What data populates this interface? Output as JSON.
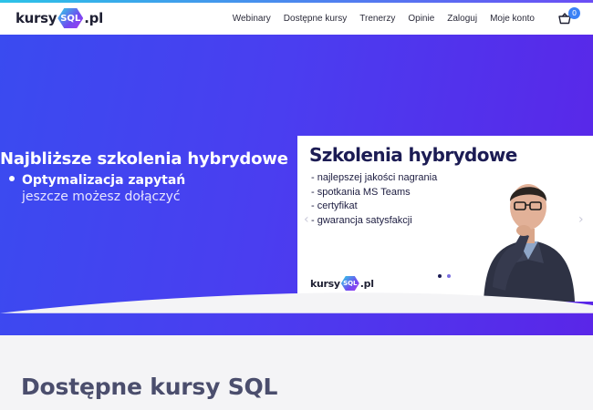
{
  "logo": {
    "left": "kursy",
    "badge": "SQL",
    "right": ".pl"
  },
  "nav": {
    "items": [
      "Webinary",
      "Dostępne kursy",
      "Trenerzy",
      "Opinie",
      "Zaloguj",
      "Moje konto"
    ]
  },
  "cart": {
    "count": "0"
  },
  "hero": {
    "title": "Najbliższe szkolenia hybrydowe",
    "course": "Optymalizacja zapytań",
    "subtitle": "jeszcze możesz dołączyć"
  },
  "slide": {
    "title": "Szkolenia hybrydowe",
    "points": [
      "- najlepszej jakości nagrania",
      "- spotkania MS Teams",
      "- certyfikat",
      "- gwarancja satysfakcji"
    ],
    "logo": {
      "left": "kursy",
      "badge": "SQL",
      "right": ".pl"
    },
    "prev_icon": "‹",
    "next_icon": "›"
  },
  "section": {
    "title": "Dostępne kursy SQL"
  },
  "colors": {
    "accent": "#4a3ef0",
    "cart_badge": "#3b82f6"
  }
}
